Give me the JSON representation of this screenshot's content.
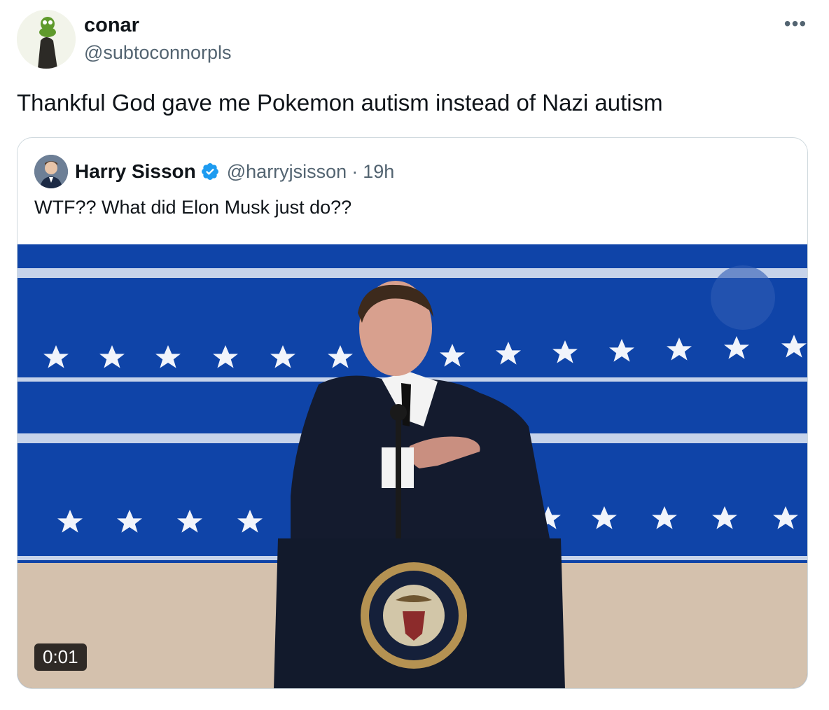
{
  "tweet": {
    "display_name": "conar",
    "handle": "@subtoconnorpls",
    "text": "Thankful God gave me Pokemon autism instead of Nazi autism",
    "more_label": "•••"
  },
  "quoted_tweet": {
    "display_name": "Harry Sisson",
    "handle": "@harryjsisson",
    "separator": "·",
    "time": "19h",
    "text": "WTF?? What did Elon Musk just do??",
    "video_duration": "0:01"
  },
  "colors": {
    "text_primary": "#0f1419",
    "text_secondary": "#536471",
    "verified_blue": "#1d9bf0",
    "border": "#cfd9de"
  }
}
